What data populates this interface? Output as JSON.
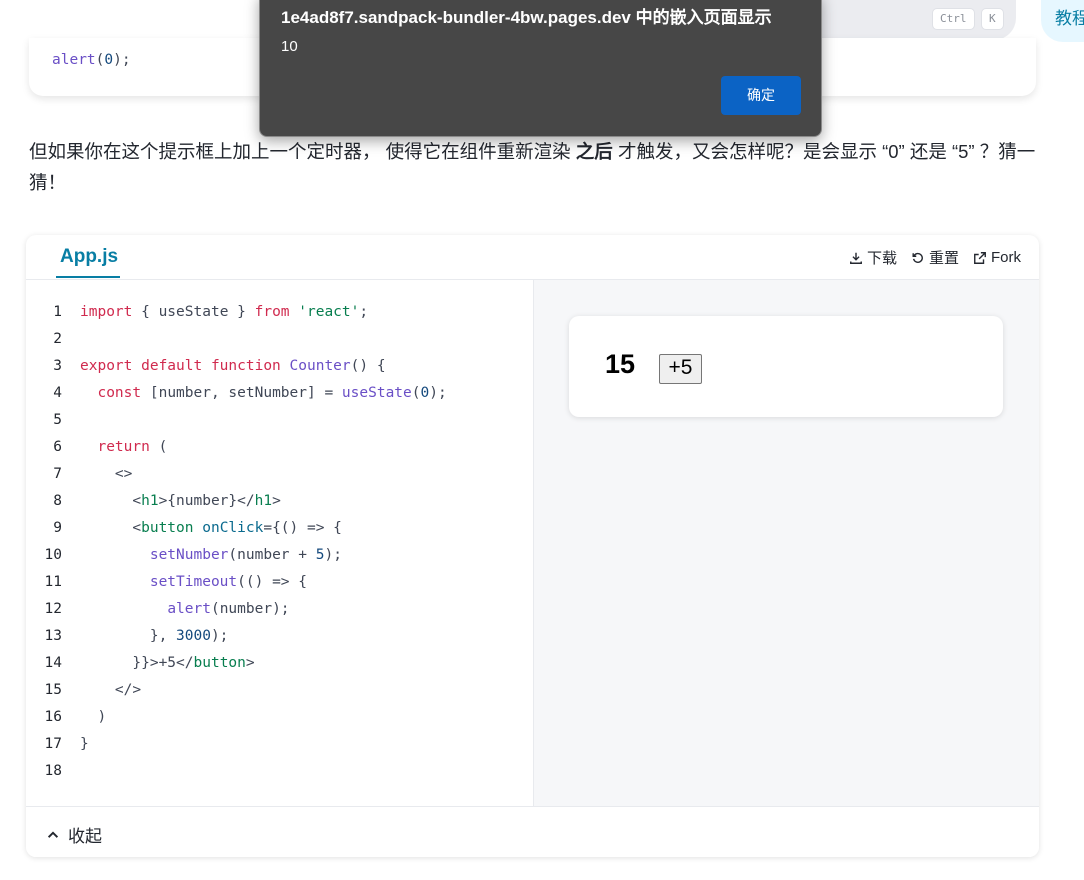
{
  "header": {
    "shortcut_ctrl": "Ctrl",
    "shortcut_k": "K",
    "tutorial_label": "教程"
  },
  "prev_code": {
    "fn": "alert",
    "open": "(",
    "num": "0",
    "close": ");"
  },
  "paragraph": {
    "part1": "但如果你在这个提示框上加上一个定时器， 使得它在组件重新渲染 ",
    "bold": "之后",
    "part2": " 才触发，又会怎样呢？是会显示 “0” 还是 “5” ？猜一猜！"
  },
  "sandpack": {
    "tab_label": "App.js",
    "actions": {
      "download": "下载",
      "reset": "重置",
      "fork": "Fork"
    },
    "code_lines": [
      [
        {
          "t": "kw",
          "v": "import"
        },
        {
          "t": "plain",
          "v": " { useState } "
        },
        {
          "t": "kw",
          "v": "from"
        },
        {
          "t": "plain",
          "v": " "
        },
        {
          "t": "str",
          "v": "'react'"
        },
        {
          "t": "plain",
          "v": ";"
        }
      ],
      [],
      [
        {
          "t": "kw",
          "v": "export default function"
        },
        {
          "t": "plain",
          "v": " "
        },
        {
          "t": "fn",
          "v": "Counter"
        },
        {
          "t": "plain",
          "v": "() {"
        }
      ],
      [
        {
          "t": "plain",
          "v": "  "
        },
        {
          "t": "kw",
          "v": "const"
        },
        {
          "t": "plain",
          "v": " [number, setNumber] = "
        },
        {
          "t": "fn",
          "v": "useState"
        },
        {
          "t": "plain",
          "v": "("
        },
        {
          "t": "num",
          "v": "0"
        },
        {
          "t": "plain",
          "v": ");"
        }
      ],
      [],
      [
        {
          "t": "plain",
          "v": "  "
        },
        {
          "t": "kw",
          "v": "return"
        },
        {
          "t": "plain",
          "v": " ("
        }
      ],
      [
        {
          "t": "plain",
          "v": "    <>"
        }
      ],
      [
        {
          "t": "plain",
          "v": "      <"
        },
        {
          "t": "tag",
          "v": "h1"
        },
        {
          "t": "plain",
          "v": ">{number}</"
        },
        {
          "t": "tag",
          "v": "h1"
        },
        {
          "t": "plain",
          "v": ">"
        }
      ],
      [
        {
          "t": "plain",
          "v": "      <"
        },
        {
          "t": "tag",
          "v": "button"
        },
        {
          "t": "plain",
          "v": " "
        },
        {
          "t": "attr",
          "v": "onClick"
        },
        {
          "t": "plain",
          "v": "={() => {"
        }
      ],
      [
        {
          "t": "plain",
          "v": "        "
        },
        {
          "t": "fn",
          "v": "setNumber"
        },
        {
          "t": "plain",
          "v": "(number + "
        },
        {
          "t": "num",
          "v": "5"
        },
        {
          "t": "plain",
          "v": ");"
        }
      ],
      [
        {
          "t": "plain",
          "v": "        "
        },
        {
          "t": "fn",
          "v": "setTimeout"
        },
        {
          "t": "plain",
          "v": "(() => {"
        }
      ],
      [
        {
          "t": "plain",
          "v": "          "
        },
        {
          "t": "fn",
          "v": "alert"
        },
        {
          "t": "plain",
          "v": "(number);"
        }
      ],
      [
        {
          "t": "plain",
          "v": "        }, "
        },
        {
          "t": "num",
          "v": "3000"
        },
        {
          "t": "plain",
          "v": ");"
        }
      ],
      [
        {
          "t": "plain",
          "v": "      }}>+5</"
        },
        {
          "t": "tag",
          "v": "button"
        },
        {
          "t": "plain",
          "v": ">"
        }
      ],
      [
        {
          "t": "plain",
          "v": "    </>"
        }
      ],
      [
        {
          "t": "plain",
          "v": "  )"
        }
      ],
      [
        {
          "t": "plain",
          "v": "}"
        }
      ],
      []
    ],
    "preview": {
      "number": "15",
      "button_label": "+5"
    },
    "collapse_label": "收起"
  },
  "alert": {
    "title": "1e4ad8f7.sandpack-bundler-4bw.pages.dev 中的嵌入页面显示",
    "message": "10",
    "ok_label": "确定"
  }
}
